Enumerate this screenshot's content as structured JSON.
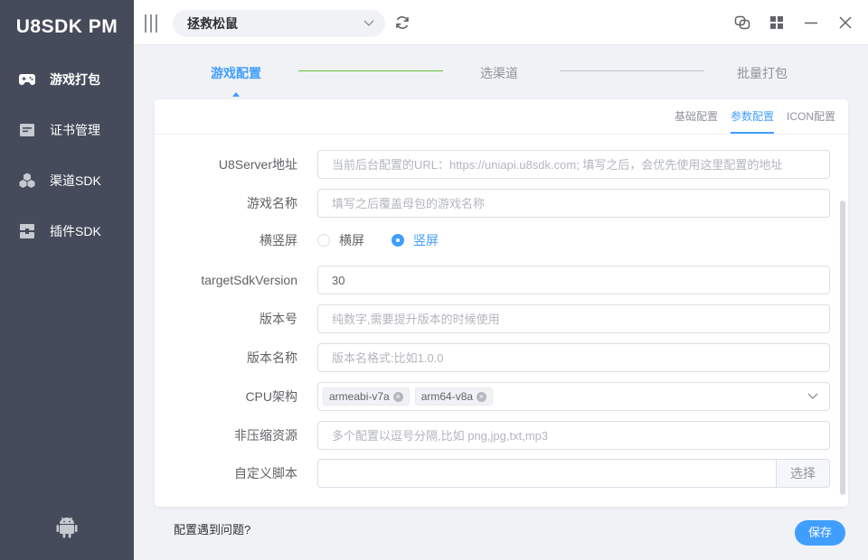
{
  "app": {
    "title": "U8SDK PM"
  },
  "sidebar": {
    "items": [
      {
        "label": "游戏打包",
        "icon": "gamepad-icon",
        "active": true
      },
      {
        "label": "证书管理",
        "icon": "certificate-icon",
        "active": false
      },
      {
        "label": "渠道SDK",
        "icon": "cubes-icon",
        "active": false
      },
      {
        "label": "插件SDK",
        "icon": "plugin-icon",
        "active": false
      }
    ],
    "footer_icon": "android-icon"
  },
  "topbar": {
    "game_select": "拯救松鼠",
    "icons": [
      "menu-toggle-icon",
      "chevron-down-icon",
      "refresh-icon",
      "link-icon",
      "grid-icon",
      "minimize-icon",
      "close-icon"
    ]
  },
  "steps": [
    {
      "label": "游戏配置",
      "active": true
    },
    {
      "label": "选渠道",
      "active": false
    },
    {
      "label": "批量打包",
      "active": false
    }
  ],
  "subtabs": [
    {
      "label": "基础配置",
      "active": false
    },
    {
      "label": "参数配置",
      "active": true
    },
    {
      "label": "ICON配置",
      "active": false
    }
  ],
  "form": {
    "u8server": {
      "label": "U8Server地址",
      "value": "",
      "placeholder": "当前后台配置的URL：https://uniapi.u8sdk.com; 填写之后，会优先使用这里配置的地址"
    },
    "game_name": {
      "label": "游戏名称",
      "value": "",
      "placeholder": "填写之后覆盖母包的游戏名称"
    },
    "orientation": {
      "label": "横竖屏",
      "options": [
        "横屏",
        "竖屏"
      ],
      "selected": "竖屏"
    },
    "target_sdk": {
      "label": "targetSdkVersion",
      "value": "30",
      "placeholder": ""
    },
    "version_code": {
      "label": "版本号",
      "value": "",
      "placeholder": "纯数字,需要提升版本的时候使用"
    },
    "version_name": {
      "label": "版本名称",
      "value": "",
      "placeholder": "版本名格式:比如1.0.0"
    },
    "cpu_arch": {
      "label": "CPU架构",
      "tags": [
        "armeabi-v7a",
        "arm64-v8a"
      ]
    },
    "no_compress": {
      "label": "非压缩资源",
      "value": "",
      "placeholder": "多个配置以逗号分隔,比如 png,jpg,txt,mp3"
    },
    "custom_script": {
      "label": "自定义脚本",
      "value": "",
      "button": "选择"
    }
  },
  "footer": {
    "help": "配置遇到问题?",
    "save": "保存"
  },
  "colors": {
    "sidebar_bg": "#454b5a",
    "accent": "#409eff",
    "step_done_line": "#67c23a",
    "page_bg": "#f0f2f5"
  }
}
